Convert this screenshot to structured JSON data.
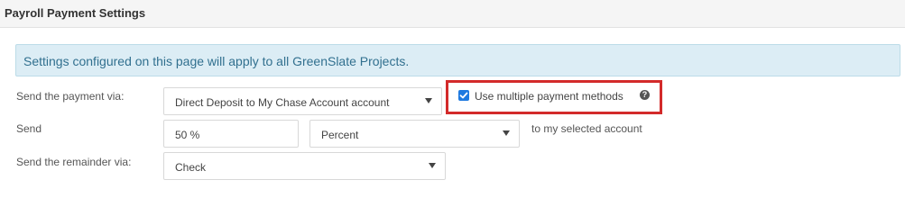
{
  "header": {
    "title": "Payroll Payment Settings"
  },
  "info": {
    "message": "Settings configured on this page will apply to all GreenSlate Projects."
  },
  "form": {
    "payment_via": {
      "label": "Send the payment via:",
      "value": "Direct Deposit to My Chase Account account"
    },
    "multiple_methods": {
      "label": "Use multiple payment methods",
      "checked": true
    },
    "send": {
      "label": "Send",
      "amount": "50 %",
      "unit": "Percent",
      "suffix": "to my selected account"
    },
    "remainder": {
      "label": "Send the remainder via:",
      "value": "Check"
    }
  },
  "colors": {
    "info_bg": "#dcedf5",
    "info_text": "#31708f",
    "highlight_border": "#d32a2a",
    "checkbox_accent": "#1f7ae0"
  },
  "icons": {
    "help": "question-circle-icon",
    "dropdown": "caret-down-icon",
    "check": "check-icon"
  }
}
